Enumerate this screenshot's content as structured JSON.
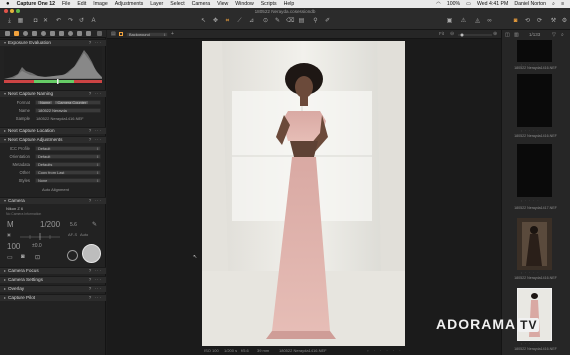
{
  "menubar": {
    "apple": "",
    "app": "Capture One 12",
    "items": [
      "File",
      "Edit",
      "Image",
      "Adjustments",
      "Layer",
      "Select",
      "Camera",
      "View",
      "Window",
      "Scripts",
      "Help"
    ],
    "battery": "100%",
    "clock": "Wed 4:41 PM",
    "user": "Daniel Norton"
  },
  "toolbar": {
    "doc_title": "180522 Nerayda.cosessiondb"
  },
  "viewbar": {
    "layer_select": "Background",
    "counter": "1/133"
  },
  "panels": {
    "exposure_evaluation": "Exposure Evaluation",
    "next_capture_naming": "Next Capture Naming",
    "naming": {
      "format_label": "Format",
      "format_tokens": [
        "Name",
        "Camera Counter"
      ],
      "name_label": "Name",
      "name_value": "180522 Nerayda",
      "sample_label": "Sample",
      "sample_value": "180522 Nerayda1416.NEF"
    },
    "next_capture_location": "Next Capture Location",
    "next_capture_adjustments": "Next Capture Adjustments",
    "adjustments": {
      "icc_label": "ICC Profile",
      "icc_value": "Default",
      "orientation_label": "Orientation",
      "orientation_value": "Default",
      "metadata_label": "Metadata",
      "metadata_value": "Defaults",
      "other_label": "Other",
      "other_value": "Copy from Last",
      "styles_label": "Styles",
      "styles_value": "None",
      "auto_alignment": "Auto Alignment"
    },
    "camera": "Camera",
    "camera_model": "Nikon Z 6",
    "camera_status": "No Camera Information",
    "camera_controls": {
      "mode": "M",
      "shutter": "1/200",
      "aperture": "5.6",
      "iso": "100",
      "ev": "±0.0",
      "af": "AF-S",
      "wb": "Auto"
    },
    "camera_focus": "Camera Focus",
    "camera_settings": "Camera Settings",
    "overlay": "Overlay",
    "capture_pilot": "Capture Pilot"
  },
  "status": {
    "iso": "ISO 100",
    "shutter": "1/200 s",
    "aperture": "f/5.6",
    "focal": "39 mm",
    "filename": "180522 Nerayda1416.NEF"
  },
  "browser": {
    "thumbnails": [
      {
        "name": "180522 Nerayda1416.NEF",
        "kind": "black"
      },
      {
        "name": "180522 Nerayda1416.NEF",
        "kind": "black"
      },
      {
        "name": "180522 Nerayda1417.NEF",
        "kind": "black"
      },
      {
        "name": "180522 Nerayda1416.NEF",
        "kind": "photo-dark"
      },
      {
        "name": "180522 Nerayda1416.NEF",
        "kind": "photo-light"
      }
    ]
  },
  "watermark": "ADORAMA TV",
  "colors": {
    "accent": "#f2a23c",
    "dress": "#d9a9a3",
    "backdrop": "#ecebe6"
  }
}
